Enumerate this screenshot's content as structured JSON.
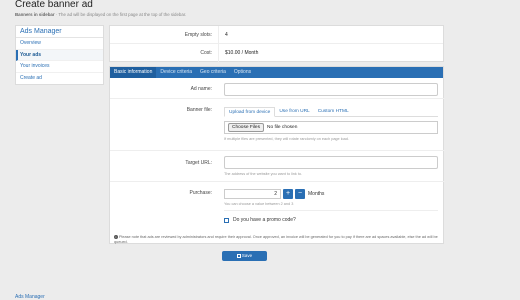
{
  "page": {
    "title": "Create banner ad",
    "subtitle_strong": "Banners in sidebar",
    "subtitle_rest": " · The ad will be displayed on the first page at the top of the sidebar."
  },
  "sidebar": {
    "title": "Ads Manager",
    "items": [
      {
        "label": "Overview"
      },
      {
        "label": "Your ads"
      },
      {
        "label": "Your invoices"
      },
      {
        "label": "Create ad"
      }
    ]
  },
  "info": {
    "empty_slots_label": "Empty slots:",
    "empty_slots_value": "4",
    "cost_label": "Cost:",
    "cost_value": "$10.00 / Month"
  },
  "tabs": [
    "Basic information",
    "Device criteria",
    "Geo criteria",
    "Options"
  ],
  "form": {
    "ad_name_label": "Ad name:",
    "banner_file_label": "Banner file:",
    "banner_tabs": [
      "Upload from device",
      "Use from URL",
      "Custom HTML"
    ],
    "choose_files": "Choose Files",
    "no_file": "No file chosen",
    "banner_help": "If multiple files are presented, they will rotate randomly on each page load.",
    "target_url_label": "Target URL:",
    "target_url_help": "The address of the website you want to link to.",
    "purchase_label": "Purchase:",
    "purchase_qty": "2",
    "plus": "+",
    "minus": "−",
    "months": "Months",
    "purchase_help": "You can choose a value between 2 and 3",
    "promo_label": "Do you have a promo code?",
    "note": "Please note that ads are reviewed by administrators and require their approval. Once approved, an invoice will be generated for you to pay if there are ad spaces available, else the ad will be queued."
  },
  "save_label": "Save",
  "footer_link": "Ads Manager",
  "colors": {
    "accent": "#2a6fb4",
    "background": "#ececec"
  }
}
